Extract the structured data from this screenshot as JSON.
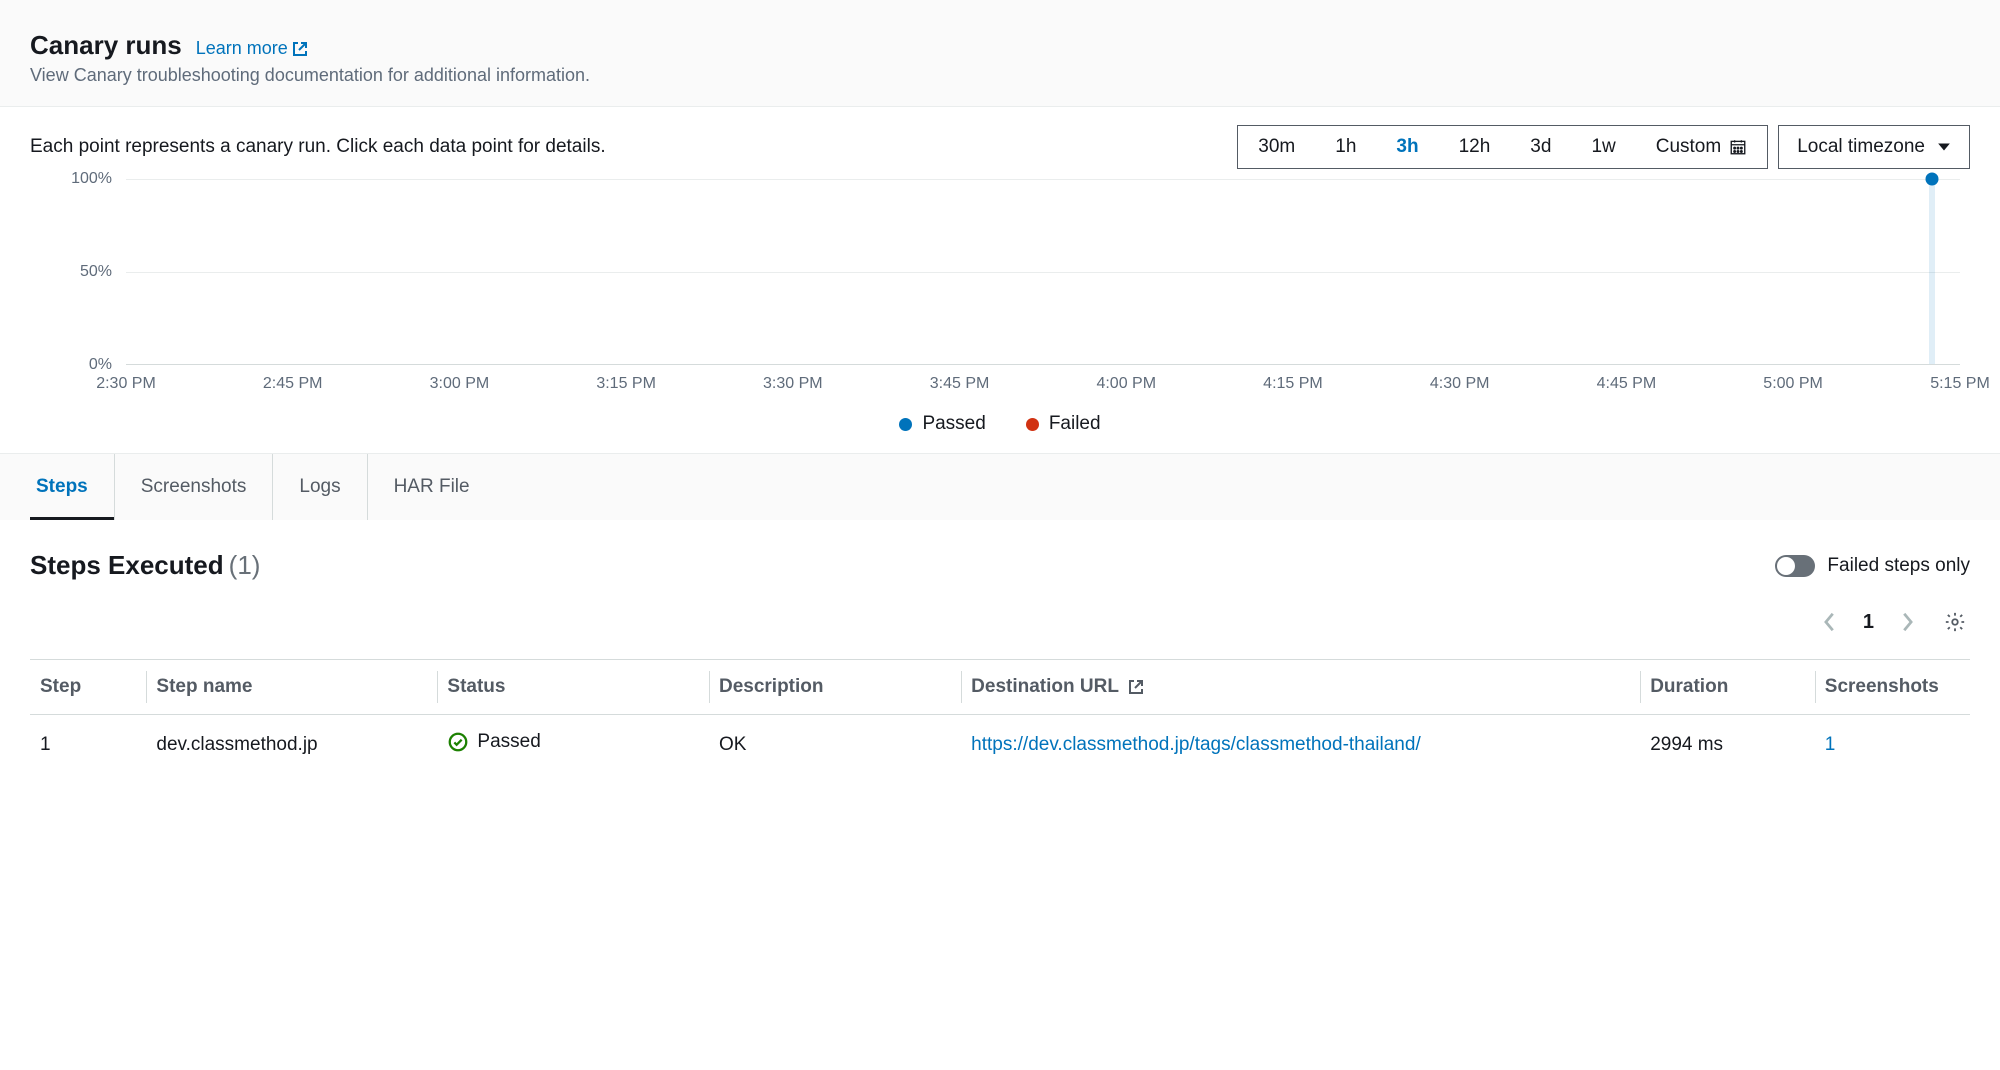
{
  "header": {
    "title": "Canary runs",
    "learn_more": "Learn more",
    "subtitle": "View Canary troubleshooting documentation for additional information."
  },
  "chart": {
    "description": "Each point represents a canary run. Click each data point for details.",
    "ranges": [
      "30m",
      "1h",
      "3h",
      "12h",
      "3d",
      "1w"
    ],
    "active_range": "3h",
    "custom_label": "Custom",
    "timezone_label": "Local timezone",
    "legend_passed": "Passed",
    "legend_failed": "Failed"
  },
  "chart_data": {
    "type": "scatter",
    "ylabel": "",
    "ylim": [
      0,
      100
    ],
    "y_ticks": [
      "0%",
      "50%",
      "100%"
    ],
    "x_ticks": [
      "2:30 PM",
      "2:45 PM",
      "3:00 PM",
      "3:15 PM",
      "3:30 PM",
      "3:45 PM",
      "4:00 PM",
      "4:15 PM",
      "4:30 PM",
      "4:45 PM",
      "5:00 PM",
      "5:15 PM"
    ],
    "series": [
      {
        "name": "Passed",
        "color": "#0073bb",
        "points": [
          {
            "x": "5:22 PM",
            "y": 100
          }
        ]
      },
      {
        "name": "Failed",
        "color": "#d13212",
        "points": []
      }
    ]
  },
  "tabs": {
    "items": [
      "Steps",
      "Screenshots",
      "Logs",
      "HAR File"
    ],
    "active": "Steps"
  },
  "steps": {
    "title": "Steps Executed",
    "count_display": "(1)",
    "toggle_label": "Failed steps only",
    "page_current": "1",
    "columns": [
      "Step",
      "Step name",
      "Status",
      "Description",
      "Destination URL",
      "Duration",
      "Screenshots"
    ],
    "rows": [
      {
        "step": "1",
        "name": "dev.classmethod.jp",
        "status": "Passed",
        "description": "OK",
        "url": "https://dev.classmethod.jp/tags/classmethod-thailand/",
        "duration": "2994 ms",
        "screenshots": "1"
      }
    ]
  }
}
